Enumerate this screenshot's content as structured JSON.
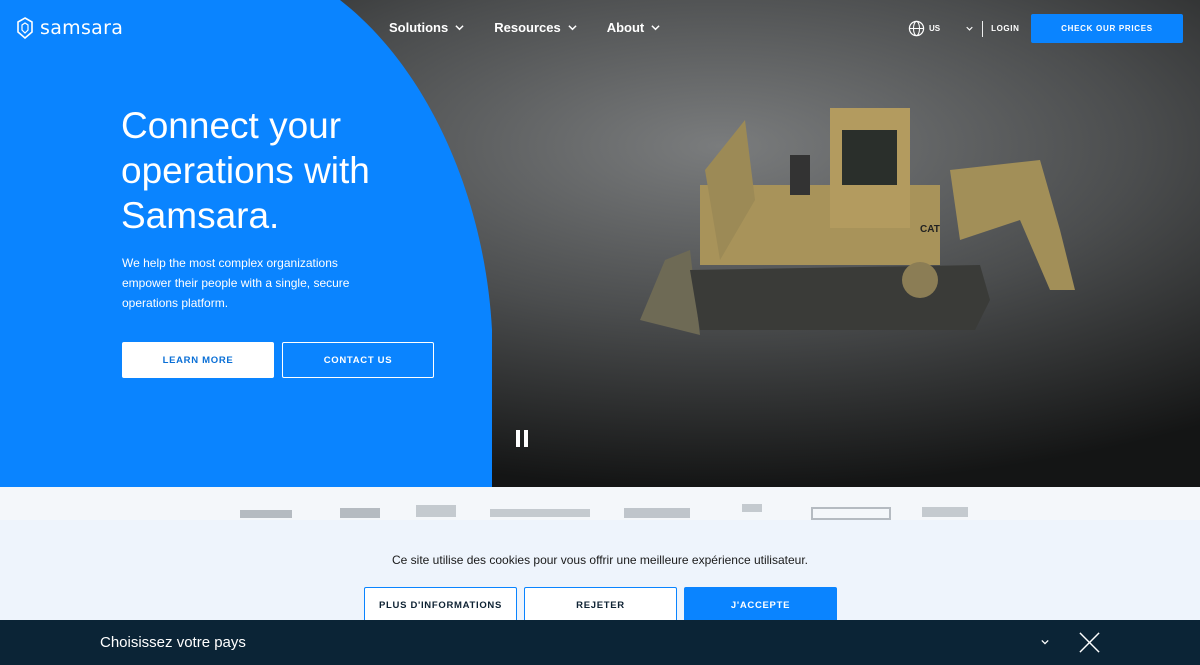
{
  "brand": {
    "name": "samsara"
  },
  "nav": {
    "items": [
      {
        "label": "Solutions"
      },
      {
        "label": "Resources"
      },
      {
        "label": "About"
      }
    ],
    "locale": "US",
    "login": "LOGIN",
    "cta": "CHECK OUR PRICES"
  },
  "hero": {
    "title": "Connect your operations with Samsara.",
    "subtitle": "We help the most complex organizations empower their people with a single, secure operations platform.",
    "primary_button": "LEARN MORE",
    "secondary_button": "CONTACT US"
  },
  "cookie_banner": {
    "text": "Ce site utilise des cookies pour vous offrir une meilleure expérience utilisateur.",
    "more_info": "PLUS D'INFORMATIONS",
    "reject": "REJETER",
    "accept": "J'ACCEPTE"
  },
  "country_bar": {
    "title": "Choisissez votre pays"
  },
  "colors": {
    "accent": "#0a84ff",
    "dark_bar": "#0b2436"
  }
}
